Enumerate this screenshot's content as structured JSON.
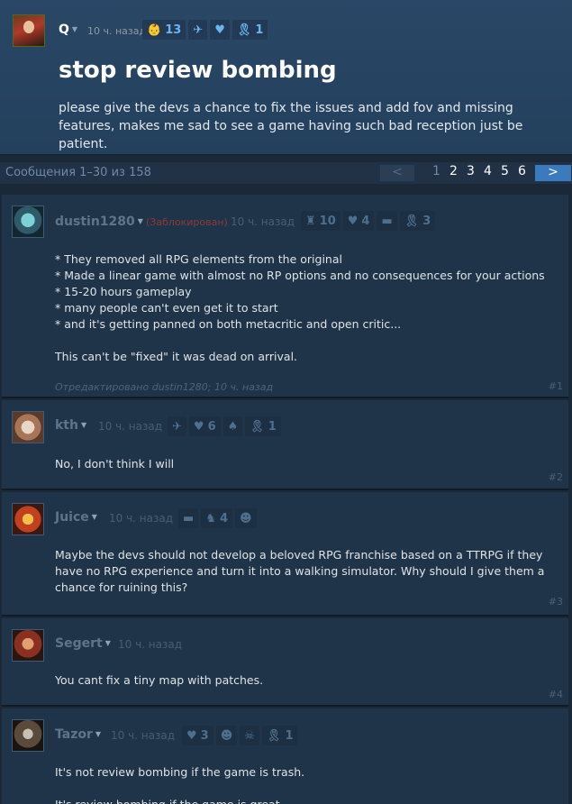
{
  "topic": {
    "author": "Q",
    "time": "10 ч. назад",
    "awards": [
      {
        "icon": "baby-face-icon",
        "glyph": "👶",
        "count": "13"
      },
      {
        "icon": "wings-icon",
        "glyph": "✈",
        "count": ""
      },
      {
        "icon": "heart-hands-icon",
        "glyph": "♥",
        "count": ""
      },
      {
        "icon": "ribbon-icon",
        "glyph": "🎗",
        "count": "1"
      }
    ],
    "title": "stop review bombing",
    "body": "please give the devs a chance to fix the issues and add fov and missing features, makes me sad to see a game having such bad reception just be patient."
  },
  "paging": {
    "summary": "Сообщения 1–30 из 158",
    "prev": "<",
    "pages": [
      "1",
      "2",
      "3",
      "4",
      "5",
      "6"
    ],
    "next": ">"
  },
  "comments": [
    {
      "author": "dustin1280",
      "blocked": "(Заблокирован)",
      "time": "10 ч. назад",
      "awards": [
        {
          "icon": "statue-icon",
          "glyph": "♜",
          "count": "10"
        },
        {
          "icon": "heart-hands-icon",
          "glyph": "♥",
          "count": "4"
        },
        {
          "icon": "pistol-icon",
          "glyph": "▬",
          "count": ""
        },
        {
          "icon": "ribbon-icon",
          "glyph": "🎗",
          "count": "3"
        }
      ],
      "text": "* They removed all RPG elements from the original\n* Made a linear game with almost no RP options and no consequences for your actions\n* 15-20 hours gameplay\n* many people can't even get it to start\n* and it's getting panned on both metacritic and open critic...\n\nThis can't be \"fixed\" it was dead on arrival.",
      "edited": "Отредактировано dustin1280; 10 ч. назад",
      "num": "#1"
    },
    {
      "author": "kth",
      "time": "10 ч. назад",
      "awards": [
        {
          "icon": "wings-icon",
          "glyph": "✈",
          "count": ""
        },
        {
          "icon": "heart-crowd-icon",
          "glyph": "♥",
          "count": "6"
        },
        {
          "icon": "thumb-icon",
          "glyph": "♠",
          "count": ""
        },
        {
          "icon": "ribbon-icon",
          "glyph": "🎗",
          "count": "1"
        }
      ],
      "text": "No, I don't think I will",
      "num": "#2"
    },
    {
      "author": "Juice",
      "time": "10 ч. назад",
      "awards": [
        {
          "icon": "pistol-icon",
          "glyph": "▬",
          "count": ""
        },
        {
          "icon": "boot-icon",
          "glyph": "♞",
          "count": "4"
        },
        {
          "icon": "baby-face-icon",
          "glyph": "☻",
          "count": ""
        }
      ],
      "text": "Maybe the devs should not develop a beloved RPG franchise based on a TTRPG if they have no RPG experience and turn it into a walking simulator. Why should I give them a chance for ruining this?",
      "num": "#3"
    },
    {
      "author": "Segert",
      "time": "10 ч. назад",
      "awards": [],
      "text": "You cant fix a tiny map with patches.",
      "num": "#4"
    },
    {
      "author": "Tazor",
      "time": "10 ч. назад",
      "awards": [
        {
          "icon": "heart-hands-icon",
          "glyph": "♥",
          "count": "3"
        },
        {
          "icon": "baby-face-icon",
          "glyph": "☻",
          "count": ""
        },
        {
          "icon": "mask-icon",
          "glyph": "☠",
          "count": ""
        },
        {
          "icon": "ribbon-icon",
          "glyph": "🎗",
          "count": "1"
        }
      ],
      "text": "It's not review bombing if the game is trash.\n\nIt's review bombing if the game is great.",
      "num": ""
    }
  ]
}
